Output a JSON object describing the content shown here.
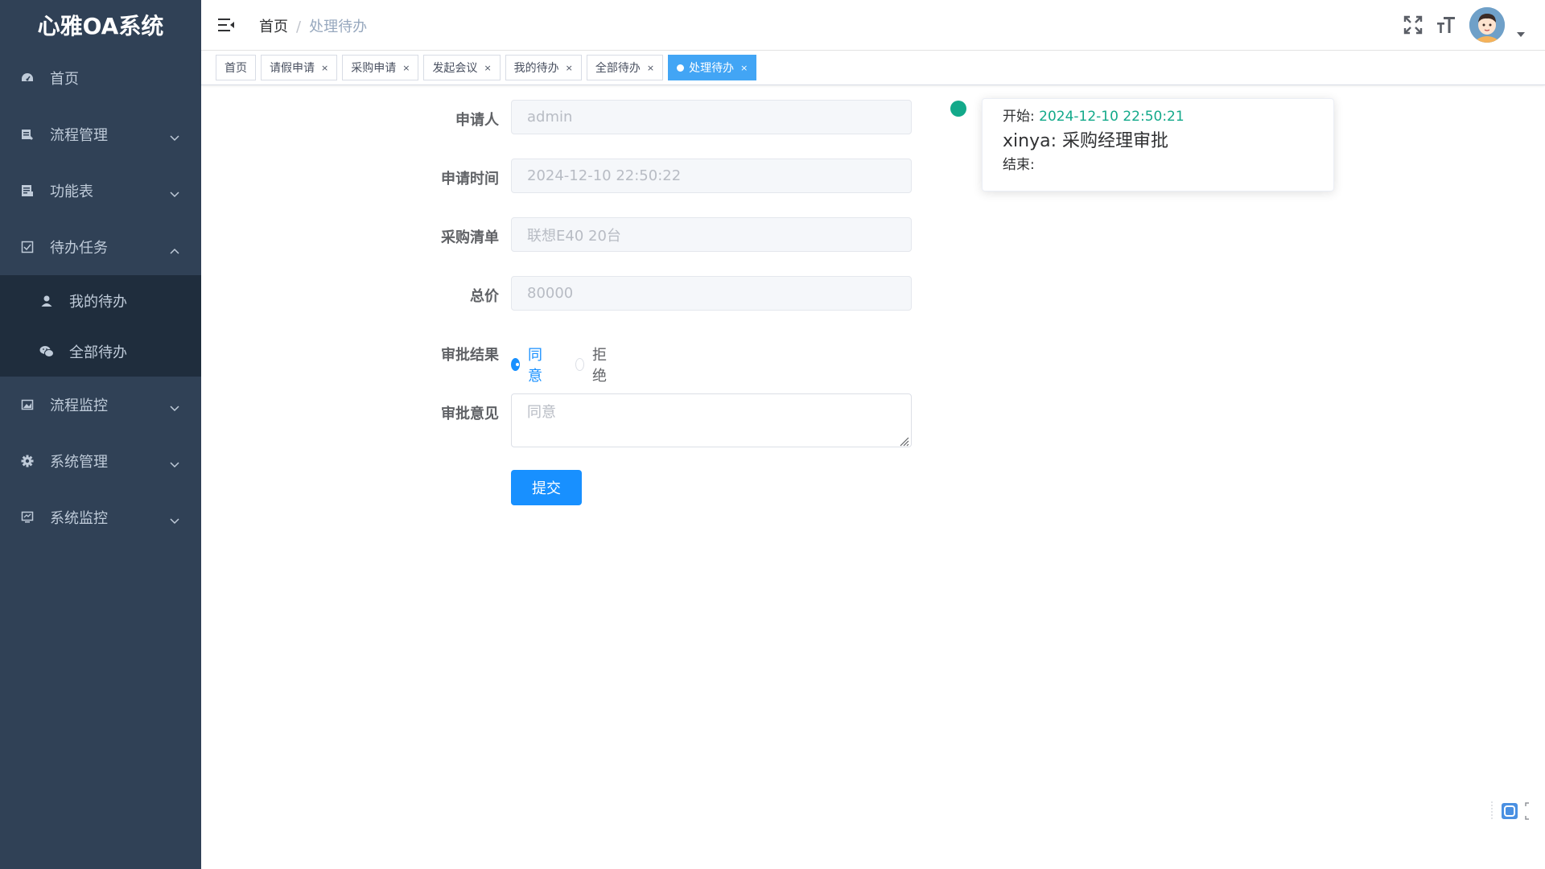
{
  "app": {
    "title": "心雅OA系统"
  },
  "sidebar": {
    "items": [
      {
        "label": "首页",
        "icon": "dashboard-icon"
      },
      {
        "label": "流程管理",
        "icon": "process-icon"
      },
      {
        "label": "功能表",
        "icon": "form-icon"
      },
      {
        "label": "待办任务",
        "icon": "checkbox-icon",
        "expanded": true
      },
      {
        "label": "流程监控",
        "icon": "monitor-image-icon"
      },
      {
        "label": "系统管理",
        "icon": "gear-icon"
      },
      {
        "label": "系统监控",
        "icon": "screen-monitor-icon"
      }
    ],
    "todo_children": [
      {
        "label": "我的待办",
        "icon": "user-icon"
      },
      {
        "label": "全部待办",
        "icon": "wechat-icon"
      }
    ]
  },
  "header": {
    "breadcrumb": {
      "home": "首页",
      "separator": "/",
      "current": "处理待办"
    }
  },
  "tags": [
    {
      "label": "首页",
      "closable": false
    },
    {
      "label": "请假申请",
      "closable": true
    },
    {
      "label": "采购申请",
      "closable": true
    },
    {
      "label": "发起会议",
      "closable": true
    },
    {
      "label": "我的待办",
      "closable": true
    },
    {
      "label": "全部待办",
      "closable": true
    },
    {
      "label": "处理待办",
      "closable": true,
      "active": true
    }
  ],
  "tag_close_glyph": "×",
  "form": {
    "applicant": {
      "label": "申请人",
      "value": "admin"
    },
    "apply_time": {
      "label": "申请时间",
      "value": "2024-12-10 22:50:22"
    },
    "purchase_list": {
      "label": "采购清单",
      "value": "联想E40 20台"
    },
    "total_price": {
      "label": "总价",
      "value": "80000"
    },
    "result": {
      "label": "审批结果",
      "options": [
        "同意",
        "拒绝"
      ],
      "selected": "同意"
    },
    "opinion": {
      "label": "审批意见",
      "value": "同意"
    },
    "submit_label": "提交"
  },
  "timeline": {
    "start_label": "开始:",
    "start_time": "2024-12-10 22:50:21",
    "title": "xinya: 采购经理审批",
    "end_label": "结束:",
    "color": "#13a98a"
  },
  "colors": {
    "sidebar_bg": "#304156",
    "submenu_bg": "#1f2d3d",
    "primary": "#1890ff",
    "active_tag": "#42a5f5"
  }
}
